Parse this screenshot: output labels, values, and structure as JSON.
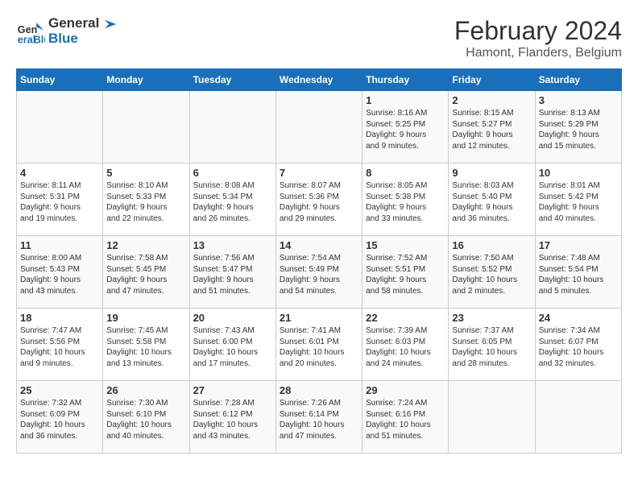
{
  "header": {
    "logo_line1": "General",
    "logo_line2": "Blue",
    "month": "February 2024",
    "location": "Hamont, Flanders, Belgium"
  },
  "weekdays": [
    "Sunday",
    "Monday",
    "Tuesday",
    "Wednesday",
    "Thursday",
    "Friday",
    "Saturday"
  ],
  "weeks": [
    [
      {
        "day": "",
        "info": ""
      },
      {
        "day": "",
        "info": ""
      },
      {
        "day": "",
        "info": ""
      },
      {
        "day": "",
        "info": ""
      },
      {
        "day": "1",
        "info": "Sunrise: 8:16 AM\nSunset: 5:25 PM\nDaylight: 9 hours\nand 9 minutes."
      },
      {
        "day": "2",
        "info": "Sunrise: 8:15 AM\nSunset: 5:27 PM\nDaylight: 9 hours\nand 12 minutes."
      },
      {
        "day": "3",
        "info": "Sunrise: 8:13 AM\nSunset: 5:29 PM\nDaylight: 9 hours\nand 15 minutes."
      }
    ],
    [
      {
        "day": "4",
        "info": "Sunrise: 8:11 AM\nSunset: 5:31 PM\nDaylight: 9 hours\nand 19 minutes."
      },
      {
        "day": "5",
        "info": "Sunrise: 8:10 AM\nSunset: 5:33 PM\nDaylight: 9 hours\nand 22 minutes."
      },
      {
        "day": "6",
        "info": "Sunrise: 8:08 AM\nSunset: 5:34 PM\nDaylight: 9 hours\nand 26 minutes."
      },
      {
        "day": "7",
        "info": "Sunrise: 8:07 AM\nSunset: 5:36 PM\nDaylight: 9 hours\nand 29 minutes."
      },
      {
        "day": "8",
        "info": "Sunrise: 8:05 AM\nSunset: 5:38 PM\nDaylight: 9 hours\nand 33 minutes."
      },
      {
        "day": "9",
        "info": "Sunrise: 8:03 AM\nSunset: 5:40 PM\nDaylight: 9 hours\nand 36 minutes."
      },
      {
        "day": "10",
        "info": "Sunrise: 8:01 AM\nSunset: 5:42 PM\nDaylight: 9 hours\nand 40 minutes."
      }
    ],
    [
      {
        "day": "11",
        "info": "Sunrise: 8:00 AM\nSunset: 5:43 PM\nDaylight: 9 hours\nand 43 minutes."
      },
      {
        "day": "12",
        "info": "Sunrise: 7:58 AM\nSunset: 5:45 PM\nDaylight: 9 hours\nand 47 minutes."
      },
      {
        "day": "13",
        "info": "Sunrise: 7:56 AM\nSunset: 5:47 PM\nDaylight: 9 hours\nand 51 minutes."
      },
      {
        "day": "14",
        "info": "Sunrise: 7:54 AM\nSunset: 5:49 PM\nDaylight: 9 hours\nand 54 minutes."
      },
      {
        "day": "15",
        "info": "Sunrise: 7:52 AM\nSunset: 5:51 PM\nDaylight: 9 hours\nand 58 minutes."
      },
      {
        "day": "16",
        "info": "Sunrise: 7:50 AM\nSunset: 5:52 PM\nDaylight: 10 hours\nand 2 minutes."
      },
      {
        "day": "17",
        "info": "Sunrise: 7:48 AM\nSunset: 5:54 PM\nDaylight: 10 hours\nand 5 minutes."
      }
    ],
    [
      {
        "day": "18",
        "info": "Sunrise: 7:47 AM\nSunset: 5:56 PM\nDaylight: 10 hours\nand 9 minutes."
      },
      {
        "day": "19",
        "info": "Sunrise: 7:45 AM\nSunset: 5:58 PM\nDaylight: 10 hours\nand 13 minutes."
      },
      {
        "day": "20",
        "info": "Sunrise: 7:43 AM\nSunset: 6:00 PM\nDaylight: 10 hours\nand 17 minutes."
      },
      {
        "day": "21",
        "info": "Sunrise: 7:41 AM\nSunset: 6:01 PM\nDaylight: 10 hours\nand 20 minutes."
      },
      {
        "day": "22",
        "info": "Sunrise: 7:39 AM\nSunset: 6:03 PM\nDaylight: 10 hours\nand 24 minutes."
      },
      {
        "day": "23",
        "info": "Sunrise: 7:37 AM\nSunset: 6:05 PM\nDaylight: 10 hours\nand 28 minutes."
      },
      {
        "day": "24",
        "info": "Sunrise: 7:34 AM\nSunset: 6:07 PM\nDaylight: 10 hours\nand 32 minutes."
      }
    ],
    [
      {
        "day": "25",
        "info": "Sunrise: 7:32 AM\nSunset: 6:09 PM\nDaylight: 10 hours\nand 36 minutes."
      },
      {
        "day": "26",
        "info": "Sunrise: 7:30 AM\nSunset: 6:10 PM\nDaylight: 10 hours\nand 40 minutes."
      },
      {
        "day": "27",
        "info": "Sunrise: 7:28 AM\nSunset: 6:12 PM\nDaylight: 10 hours\nand 43 minutes."
      },
      {
        "day": "28",
        "info": "Sunrise: 7:26 AM\nSunset: 6:14 PM\nDaylight: 10 hours\nand 47 minutes."
      },
      {
        "day": "29",
        "info": "Sunrise: 7:24 AM\nSunset: 6:16 PM\nDaylight: 10 hours\nand 51 minutes."
      },
      {
        "day": "",
        "info": ""
      },
      {
        "day": "",
        "info": ""
      }
    ]
  ]
}
